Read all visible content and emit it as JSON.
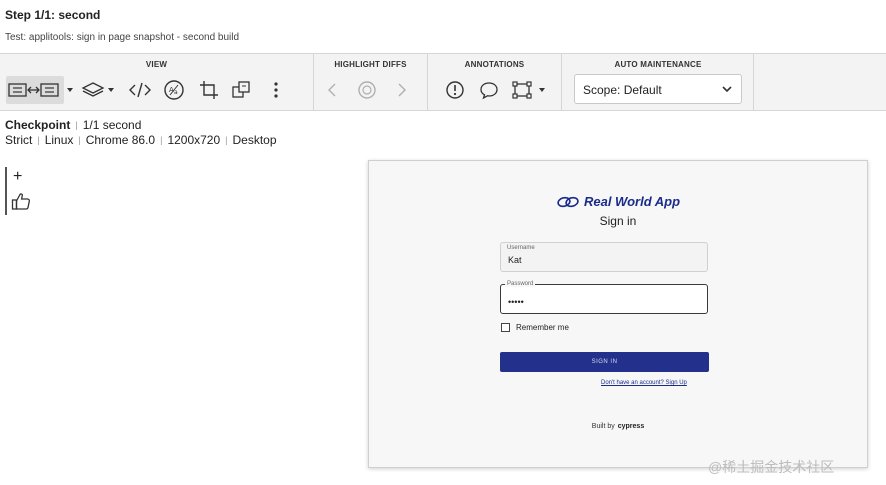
{
  "header": {
    "step_title": "Step 1/1: second",
    "test_subtitle": "Test: applitools: sign in page snapshot - second build"
  },
  "toolbar": {
    "view_label": "VIEW",
    "highlight_label": "HIGHLIGHT DIFFS",
    "annotations_label": "ANNOTATIONS",
    "auto_label": "AUTO MAINTENANCE",
    "scope_value": "Scope: Default",
    "view_icons": [
      "side-by-side-compare-icon",
      "layers-icon",
      "code-icon",
      "accessibility-icon",
      "crop-icon",
      "copy-icon",
      "more-vertical-icon"
    ],
    "highlight_icons": [
      "chevron-left-icon",
      "highlight-toggle-icon",
      "chevron-right-icon"
    ],
    "annotation_icons": [
      "alert-circle-icon",
      "comment-icon",
      "region-icon"
    ]
  },
  "checkpoint": {
    "label": "Checkpoint",
    "value": "1/1 second",
    "meta": [
      "Strict",
      "Linux",
      "Chrome 86.0",
      "1200x720",
      "Desktop"
    ]
  },
  "side_tools": {
    "plus": "+"
  },
  "snapshot": {
    "app_name": "Real World App",
    "heading": "Sign in",
    "username_label": "Username",
    "username_value": "Kat",
    "password_label": "Password",
    "password_value": "•••••",
    "remember_label": "Remember me",
    "signin_button": "SIGN IN",
    "signup_link": "Don't have an account? Sign Up",
    "built_by": "Built by",
    "built_by_brand": "cypress"
  },
  "watermark": "@稀土掘金技术社区",
  "colors": {
    "brand_blue": "#1a2b8c",
    "button_blue": "#23308c",
    "toolbar_bg": "#f3f3f3"
  }
}
